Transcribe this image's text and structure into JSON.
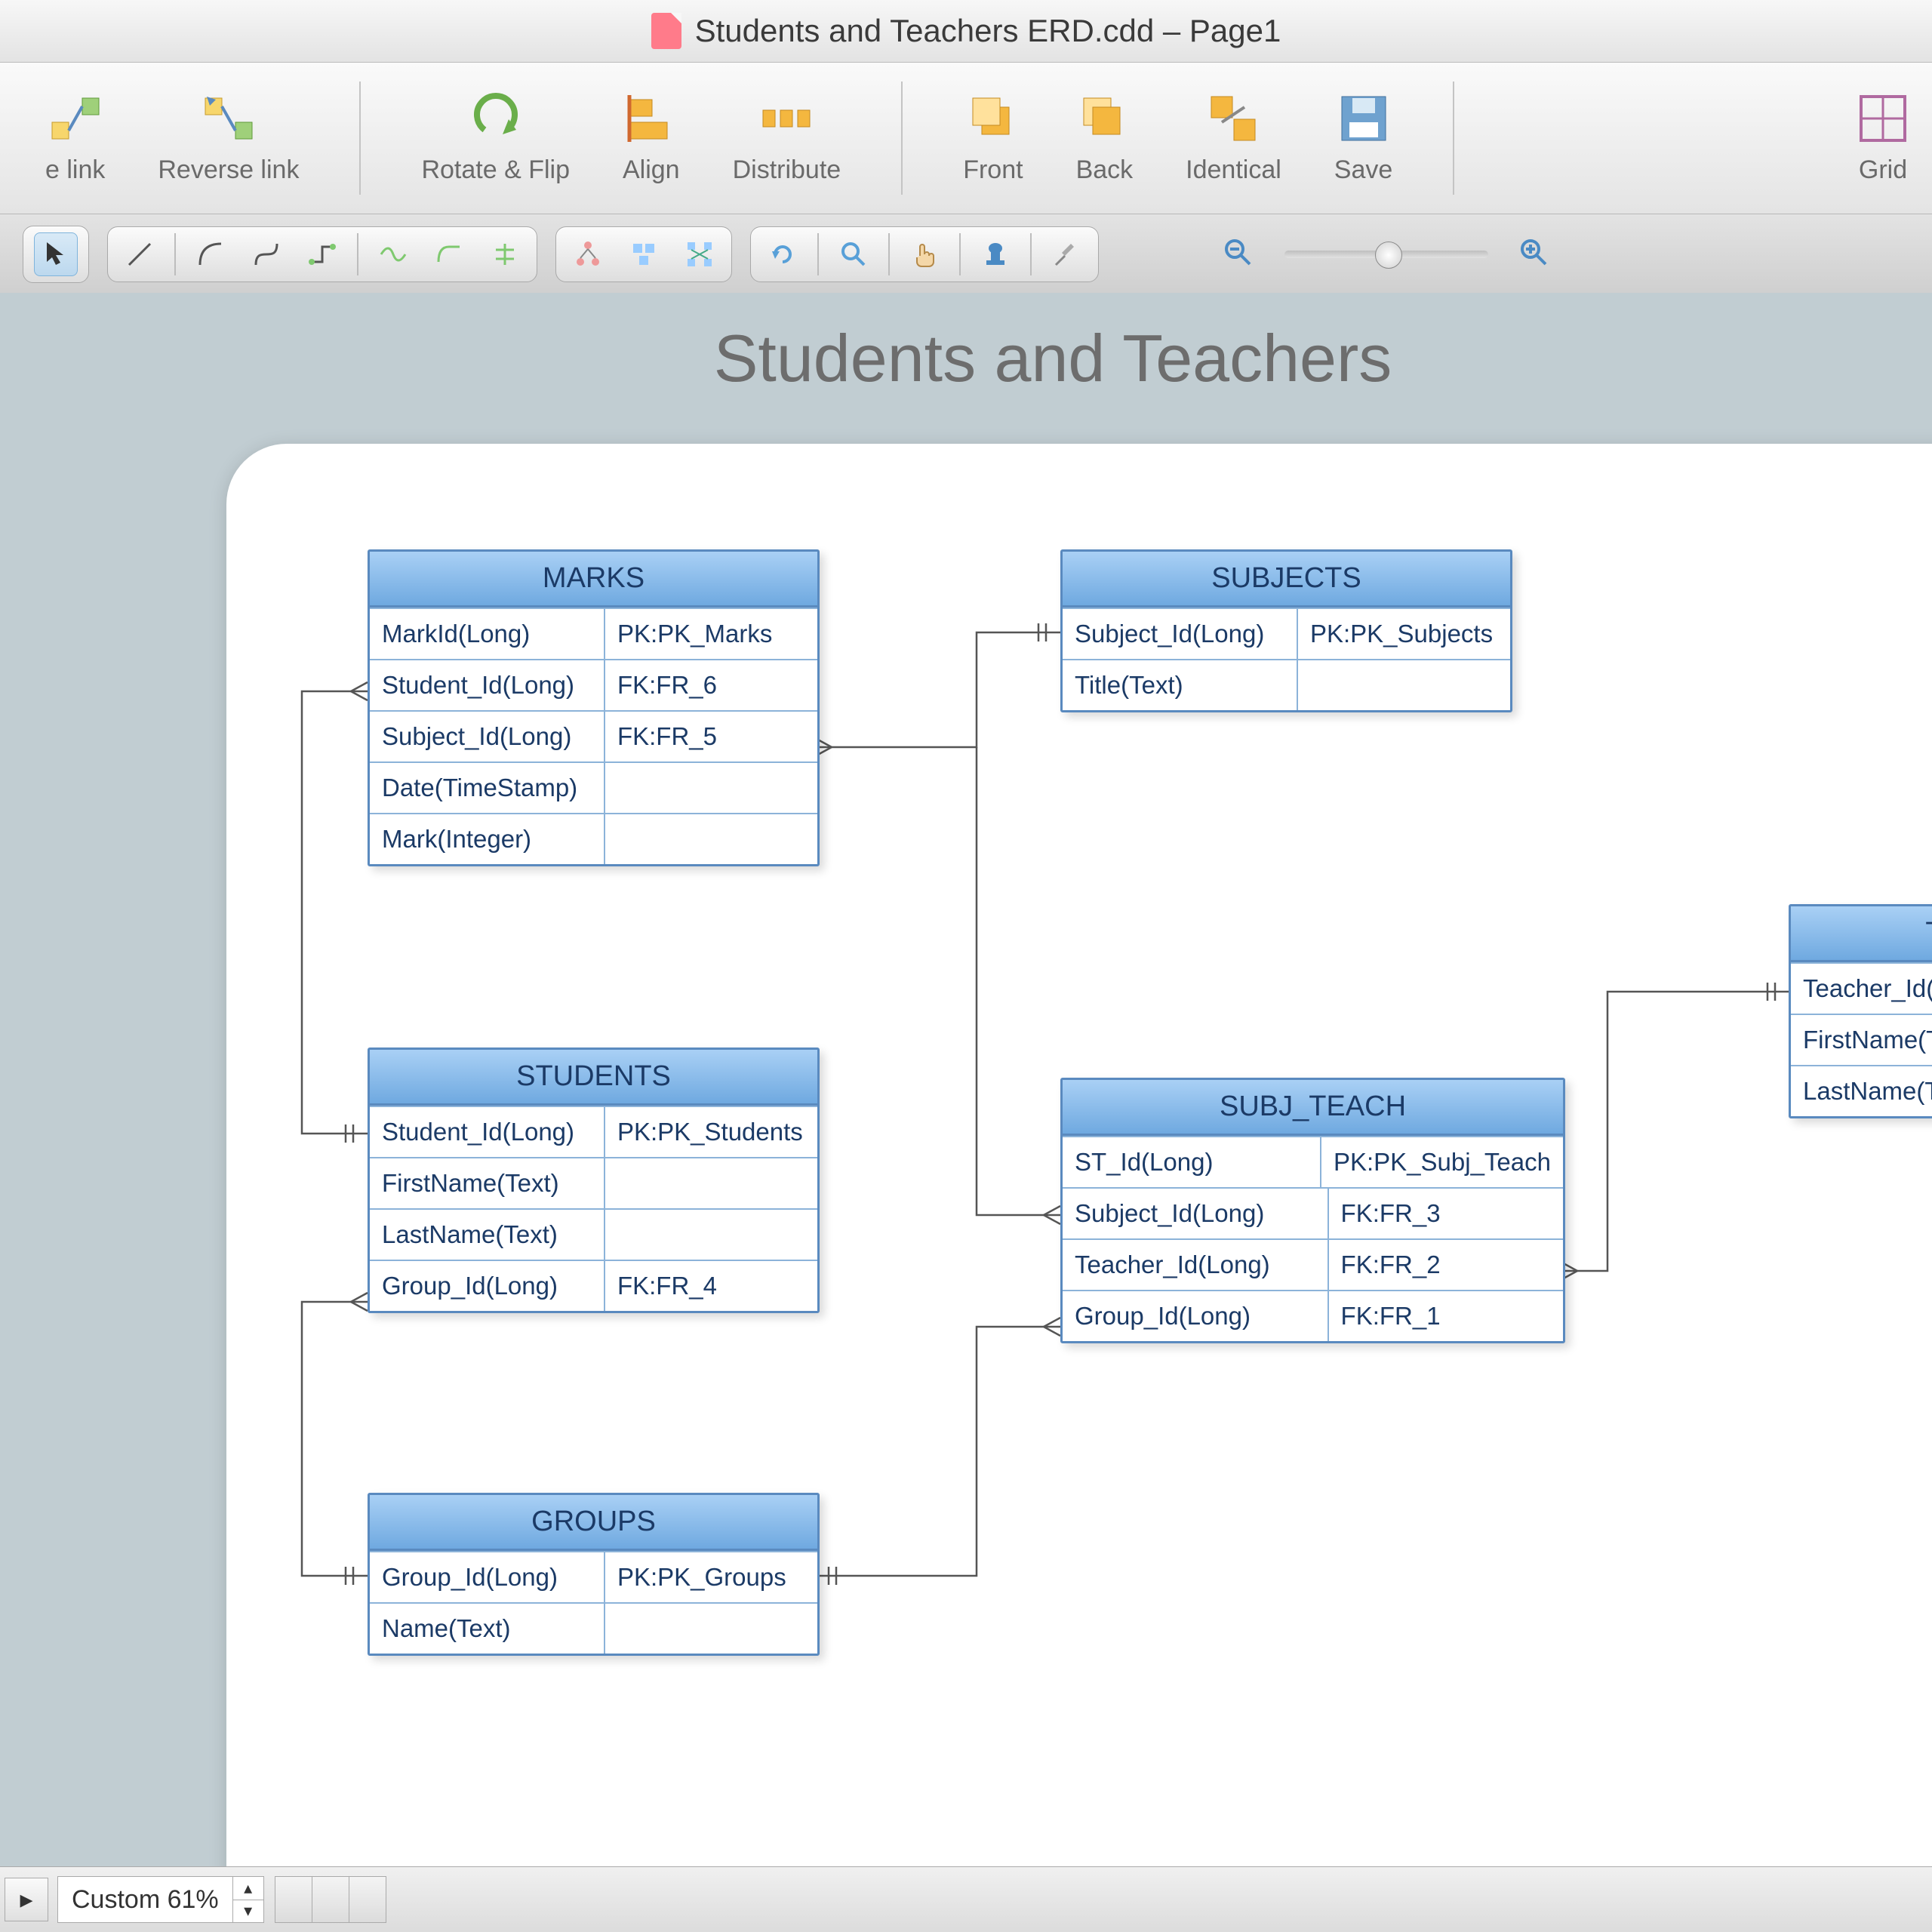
{
  "window": {
    "title": "Students and Teachers ERD.cdd – Page1"
  },
  "ribbon": {
    "link": "e link",
    "reverse_link": "Reverse link",
    "rotate_flip": "Rotate & Flip",
    "align": "Align",
    "distribute": "Distribute",
    "front": "Front",
    "back": "Back",
    "identical": "Identical",
    "save": "Save",
    "grid": "Grid"
  },
  "canvas": {
    "title": "Students and Teachers"
  },
  "entities": {
    "marks": {
      "name": "MARKS",
      "rows": [
        {
          "c1": "MarkId(Long)",
          "c2": "PK:PK_Marks"
        },
        {
          "c1": "Student_Id(Long)",
          "c2": "FK:FR_6"
        },
        {
          "c1": "Subject_Id(Long)",
          "c2": "FK:FR_5"
        },
        {
          "c1": "Date(TimeStamp)",
          "c2": ""
        },
        {
          "c1": "Mark(Integer)",
          "c2": ""
        }
      ]
    },
    "subjects": {
      "name": "SUBJECTS",
      "rows": [
        {
          "c1": "Subject_Id(Long)",
          "c2": "PK:PK_Subjects"
        },
        {
          "c1": "Title(Text)",
          "c2": ""
        }
      ]
    },
    "students": {
      "name": "STUDENTS",
      "rows": [
        {
          "c1": "Student_Id(Long)",
          "c2": "PK:PK_Students"
        },
        {
          "c1": "FirstName(Text)",
          "c2": ""
        },
        {
          "c1": "LastName(Text)",
          "c2": ""
        },
        {
          "c1": "Group_Id(Long)",
          "c2": "FK:FR_4"
        }
      ]
    },
    "subj_teach": {
      "name": "SUBJ_TEACH",
      "rows": [
        {
          "c1": "ST_Id(Long)",
          "c2": "PK:PK_Subj_Teach"
        },
        {
          "c1": "Subject_Id(Long)",
          "c2": "FK:FR_3"
        },
        {
          "c1": "Teacher_Id(Long)",
          "c2": "FK:FR_2"
        },
        {
          "c1": "Group_Id(Long)",
          "c2": "FK:FR_1"
        }
      ]
    },
    "groups": {
      "name": "GROUPS",
      "rows": [
        {
          "c1": "Group_Id(Long)",
          "c2": "PK:PK_Groups"
        },
        {
          "c1": "Name(Text)",
          "c2": ""
        }
      ]
    },
    "teachers": {
      "name": "T",
      "rows": [
        {
          "c1": "Teacher_Id(L",
          "c2": ""
        },
        {
          "c1": "FirstName(Te",
          "c2": ""
        },
        {
          "c1": "LastName(Te",
          "c2": ""
        }
      ]
    }
  },
  "status": {
    "zoom": "Custom 61%"
  }
}
